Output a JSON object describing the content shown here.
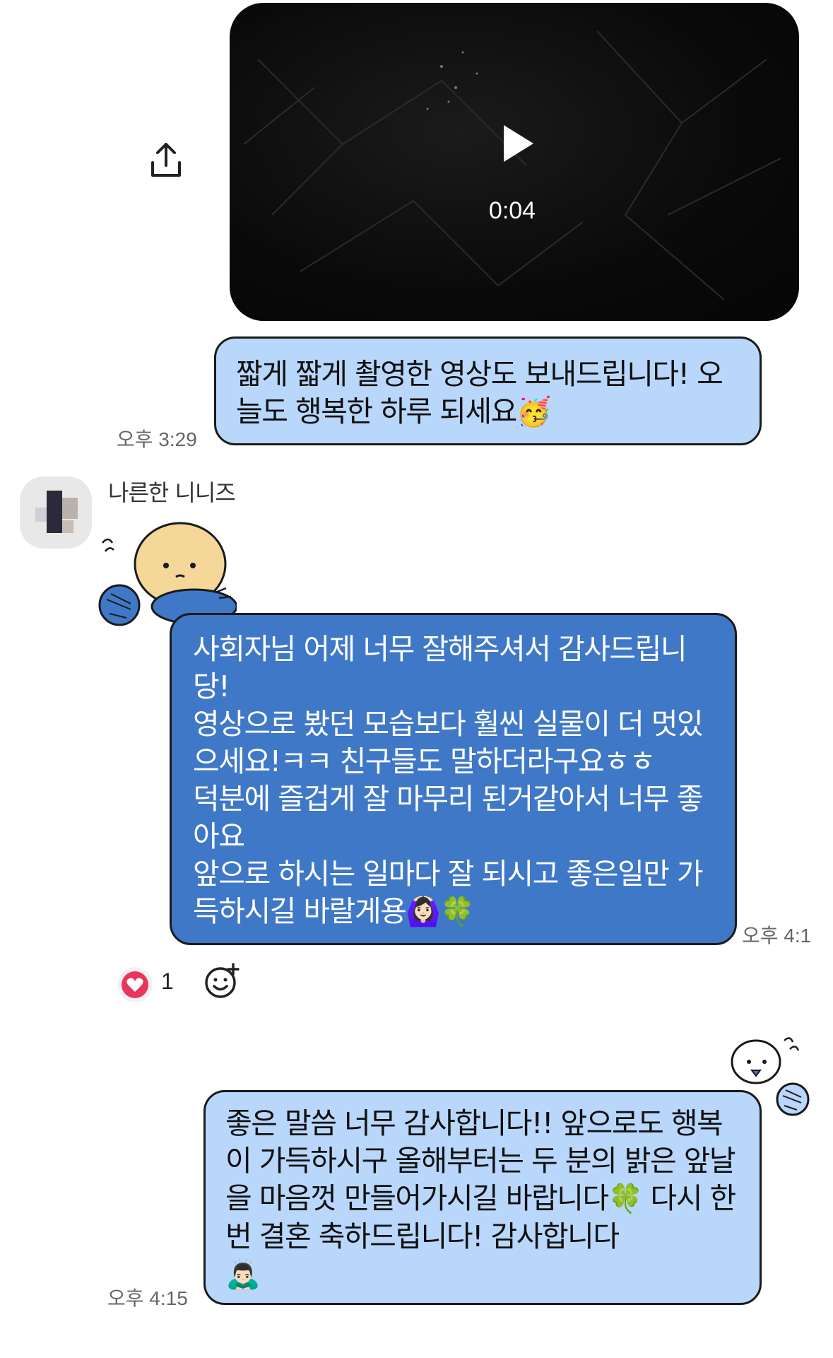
{
  "video": {
    "duration": "0:04"
  },
  "messages": {
    "m1": {
      "text": "짧게 짧게 촬영한 영상도 보내드립니다! 오늘도 행복한 하루 되세요",
      "emoji": "🥳",
      "time": "오후 3:29"
    },
    "m2": {
      "sender": "나른한 니니즈",
      "lines": [
        "사회자님 어제 너무 잘해주셔서 감사드립니당!",
        "영상으로 봤던 모습보다 훨씬 실물이 더 멋있으세요!ㅋㅋ 친구들도 말하더라구요ㅎㅎ",
        "덕분에 즐겁게 잘 마무리 된거같아서 너무 좋아요",
        "앞으로 하시는 일마다 잘 되시고 좋은일만 가득하시길 바랄게용"
      ],
      "emoji_end": "🙆🏻‍♀️🍀",
      "time": "오후 4:1",
      "reaction_count": "1"
    },
    "m3": {
      "text": "좋은 말씀 너무 감사합니다!! 앞으로도 행복이 가득하시구 올해부터는 두 분의 밝은 앞날을 마음껏 만들어가시길 바랍니다",
      "emoji_mid": "🍀",
      "text2": " 다시 한 번 결혼 축하드립니다! 감사합니다",
      "emoji_end": "🙇🏻‍♂️",
      "time": "오후 4:15"
    }
  },
  "colors": {
    "sent_bubble": "#b9d7fb",
    "received_bubble": "#3f78c7",
    "heart": "#e8365d"
  },
  "icons": [
    "share-icon",
    "play-icon",
    "heart-icon",
    "add-reaction-icon"
  ]
}
